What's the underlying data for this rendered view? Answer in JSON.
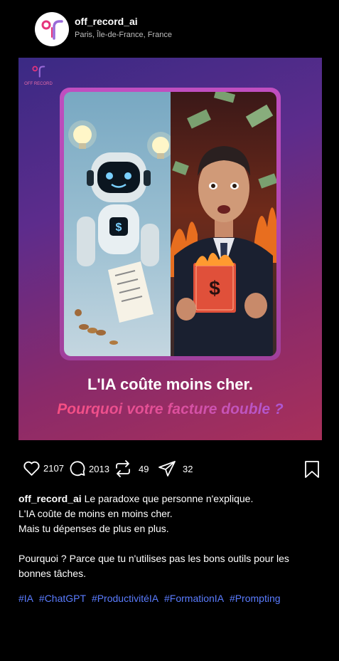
{
  "post": {
    "username": "off_record_ai",
    "location": "Paris, Île-de-France, France",
    "image": {
      "brand_text": "OFF RECORD",
      "headline": "L'IA coûte moins cher.",
      "subline": "Pourquoi votre facture double ?"
    },
    "stats": {
      "likes": "2107",
      "comments": "2013",
      "reposts": "49",
      "shares": "32"
    },
    "caption": {
      "line1": "Le paradoxe que personne n'explique.",
      "line2": "L'IA coûte de moins en moins cher.",
      "line3": "Mais tu dépenses de plus en plus.",
      "line4": "Pourquoi ? Parce que tu n'utilises pas les bons outils pour les bonnes tâches."
    },
    "hashtags": [
      "#IA",
      "#ChatGPT",
      "#ProductivitéIA",
      "#FormationIA",
      "#Prompting"
    ]
  },
  "colors": {
    "hashtag": "#5a7cff",
    "background": "#000000",
    "accent_pink": "#e5347c"
  },
  "icons": [
    "heart-icon",
    "comment-icon",
    "repost-icon",
    "share-icon",
    "bookmark-icon"
  ]
}
